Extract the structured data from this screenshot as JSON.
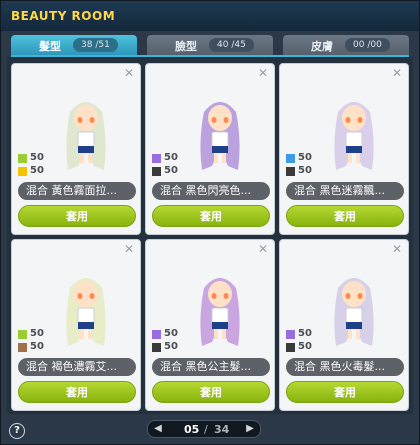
{
  "title": "BEAUTY ROOM",
  "tabs": [
    {
      "name": "髮型",
      "count": "38 /51",
      "active": true
    },
    {
      "name": "臉型",
      "count": "40 /45",
      "active": false
    },
    {
      "name": "皮膚",
      "count": "00 /00",
      "active": false
    }
  ],
  "cards": [
    {
      "label": "混合  黃色霧面拉...",
      "c1": {
        "color": "#9acd32",
        "value": "50"
      },
      "c2": {
        "color": "#f2c500",
        "value": "50"
      },
      "hair": "#dfe7cf",
      "button": "套用"
    },
    {
      "label": "混合  黑色閃亮色...",
      "c1": {
        "color": "#9b6be0",
        "value": "50"
      },
      "c2": {
        "color": "#3a3a3a",
        "value": "50"
      },
      "hair": "#b9a2de",
      "button": "套用"
    },
    {
      "label": "混合  黑色迷霧飄...",
      "c1": {
        "color": "#3c9be6",
        "value": "50"
      },
      "c2": {
        "color": "#3a3a3a",
        "value": "50"
      },
      "hair": "#d9cfea",
      "button": "套用"
    },
    {
      "label": "混合  褐色濃霧艾...",
      "c1": {
        "color": "#9acd32",
        "value": "50"
      },
      "c2": {
        "color": "#a0704a",
        "value": "50"
      },
      "hair": "#e8edc8",
      "button": "套用"
    },
    {
      "label": "混合  黑色公主髮...",
      "c1": {
        "color": "#9b6be0",
        "value": "50"
      },
      "c2": {
        "color": "#3a3a3a",
        "value": "50"
      },
      "hair": "#c9a6df",
      "button": "套用"
    },
    {
      "label": "混合  黑色火毒髮...",
      "c1": {
        "color": "#9b6be0",
        "value": "50"
      },
      "c2": {
        "color": "#3a3a3a",
        "value": "50"
      },
      "hair": "#d6d0e8",
      "button": "套用"
    }
  ],
  "footer": {
    "help": "?",
    "page_current": "05",
    "page_sep": "/",
    "page_total": "34"
  }
}
